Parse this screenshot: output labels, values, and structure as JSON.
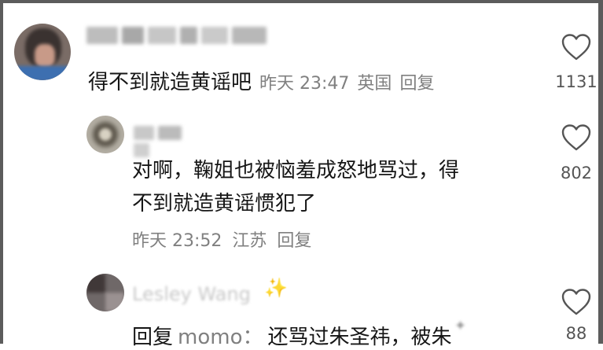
{
  "comments": [
    {
      "text": "得不到就造黄谣吧",
      "time": "昨天 23:47",
      "location": "英国",
      "reply_label": "回复",
      "likes": "1131"
    },
    {
      "text_line1": "对啊，鞠姐也被恼羞成怒地骂过，得",
      "text_line2": "不到就造黄谣惯犯了",
      "time": "昨天 23:52",
      "location": "江苏",
      "reply_label": "回复",
      "likes": "802"
    },
    {
      "username": "Lesley Wang",
      "reply_prefix": "回复",
      "mention": "momo：",
      "text": "还骂过朱圣祎，被朱",
      "likes": "88"
    }
  ],
  "icons": {
    "like": "heart-outline-icon"
  },
  "colors": {
    "text": "#161616",
    "meta": "#808080",
    "icon": "#555555"
  }
}
